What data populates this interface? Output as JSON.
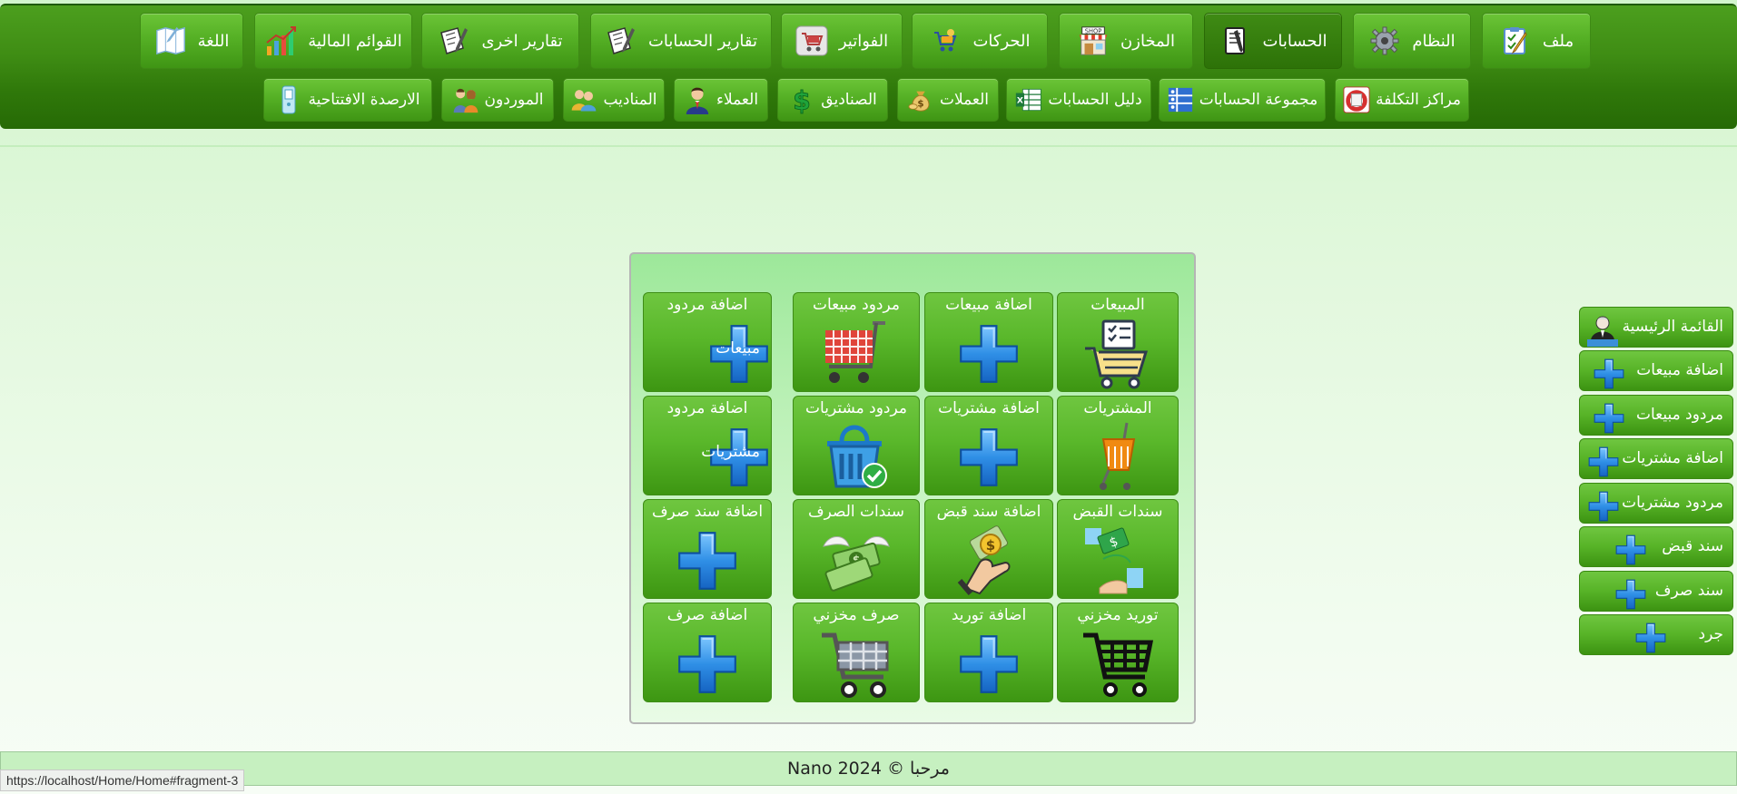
{
  "nav_main": [
    {
      "label": "ملف",
      "icon": "checklist-icon"
    },
    {
      "label": "النظام",
      "icon": "gear-icon"
    },
    {
      "label": "الحسابات",
      "icon": "ledger-icon",
      "active": true
    },
    {
      "label": "المخازن",
      "icon": "shop-icon"
    },
    {
      "label": "الحركات",
      "icon": "cart-icon"
    },
    {
      "label": "الفواتير",
      "icon": "invoice-cart-icon"
    },
    {
      "label": "تقارير الحسابات",
      "icon": "report-icon"
    },
    {
      "label": "تقارير اخرى",
      "icon": "report-icon"
    },
    {
      "label": "القوائم المالية",
      "icon": "bar-chart-icon"
    },
    {
      "label": "اللغة",
      "icon": "map-icon"
    }
  ],
  "nav_sub": [
    {
      "label": "مراكز التكلفة",
      "icon": "cost-center-icon"
    },
    {
      "label": "مجموعة الحسابات",
      "icon": "account-group-icon"
    },
    {
      "label": "دليل الحسابات",
      "icon": "excel-icon"
    },
    {
      "label": "العملات",
      "icon": "money-bag-icon"
    },
    {
      "label": "الصناديق",
      "icon": "dollar-icon"
    },
    {
      "label": "العملاء",
      "icon": "customer-icon"
    },
    {
      "label": "المناديب",
      "icon": "delegates-icon"
    },
    {
      "label": "الموردون",
      "icon": "suppliers-icon"
    },
    {
      "label": "الارصدة الافتتاحية",
      "icon": "opening-balance-icon"
    }
  ],
  "tiles": [
    {
      "label": "المبيعات",
      "icon": "sales-cart-icon"
    },
    {
      "label": "اضافة مبيعات",
      "icon": "plus-icon"
    },
    {
      "label": "مردود مبيعات",
      "icon": "red-cart-icon"
    },
    {
      "label": "اضافة مردود",
      "label2": "مبيعات",
      "icon": "plus-icon"
    },
    {
      "label": "المشتريات",
      "icon": "orange-basket-icon"
    },
    {
      "label": "اضافة مشتريات",
      "icon": "plus-icon"
    },
    {
      "label": "مردود مشتريات",
      "icon": "blue-basket-icon"
    },
    {
      "label": "اضافة مردود",
      "label2": "مشتريات",
      "icon": "plus-icon"
    },
    {
      "label": "سندات القبض",
      "icon": "hand-money-icon"
    },
    {
      "label": "اضافة سند قبض",
      "icon": "coin-hand-icon"
    },
    {
      "label": "سندات الصرف",
      "icon": "flying-money-icon"
    },
    {
      "label": "اضافة سند صرف",
      "icon": "plus-icon"
    },
    {
      "label": "توريد مخزني",
      "icon": "black-cart-icon"
    },
    {
      "label": "اضافة توريد",
      "icon": "plus-icon"
    },
    {
      "label": "صرف مخزني",
      "icon": "grey-cart-icon"
    },
    {
      "label": "اضافة صرف",
      "icon": "plus-icon"
    }
  ],
  "side_menu": [
    {
      "label": "القائمة الرئيسية",
      "icon": "user-desk-icon"
    },
    {
      "label": "اضافة مبيعات",
      "icon": "plus-icon"
    },
    {
      "label": "مردود مبيعات",
      "icon": "plus-icon"
    },
    {
      "label": "اضافة مشتريات",
      "icon": "plus-icon"
    },
    {
      "label": "مردود مشتريات",
      "icon": "plus-icon"
    },
    {
      "label": "سند قبض",
      "icon": "plus-icon"
    },
    {
      "label": "سند صرف",
      "icon": "plus-icon"
    },
    {
      "label": "جرد",
      "icon": "plus-icon"
    }
  ],
  "footer": {
    "text": "Nano 2024 © مرحبا"
  },
  "status_url": "https://localhost/Home/Home#fragment-3"
}
